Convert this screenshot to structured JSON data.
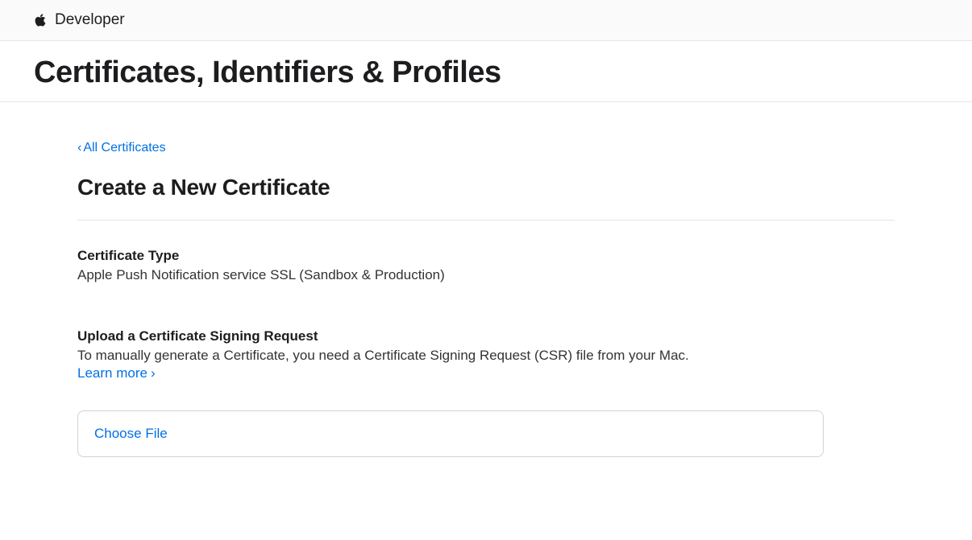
{
  "header": {
    "developer_label": "Developer"
  },
  "page": {
    "title": "Certificates, Identifiers & Profiles"
  },
  "content": {
    "back_link": "All Certificates",
    "section_title": "Create a New Certificate",
    "cert_type_label": "Certificate Type",
    "cert_type_value": "Apple Push Notification service SSL (Sandbox & Production)",
    "upload_heading": "Upload a Certificate Signing Request",
    "upload_description": "To manually generate a Certificate, you need a Certificate Signing Request (CSR) file from your Mac.",
    "learn_more": "Learn more",
    "choose_file": "Choose File"
  }
}
